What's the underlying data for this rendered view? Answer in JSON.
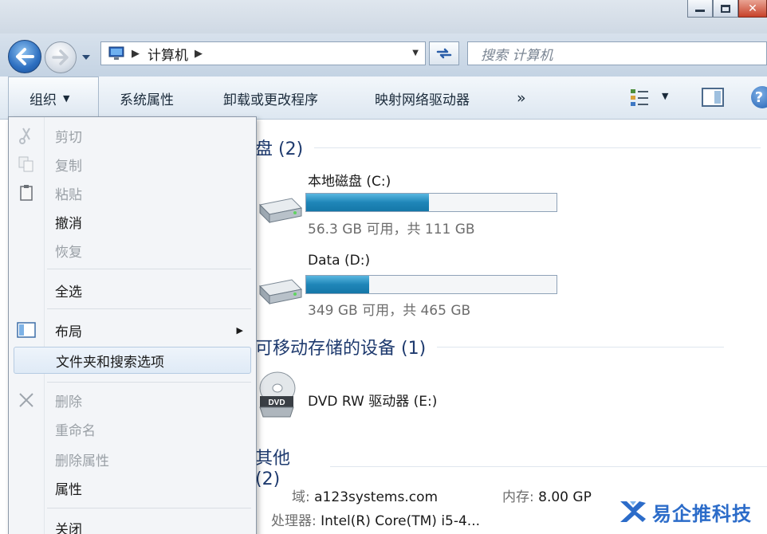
{
  "address_bar": {
    "breadcrumb": "计算机",
    "search_placeholder": "搜索 计算机"
  },
  "toolbar": {
    "organize": "组织",
    "system_properties": "系统属性",
    "uninstall": "卸载或更改程序",
    "map_drive": "映射网络驱动器",
    "more": "»"
  },
  "groups": {
    "hard_disks": "盘 (2)",
    "removable": "可移动存储的设备 (1)",
    "other": "其他 (2)"
  },
  "drives": [
    {
      "name": "本地磁盘 (C:)",
      "free_text": "56.3 GB 可用，共 111 GB",
      "used_fraction": 0.49
    },
    {
      "name": "Data (D:)",
      "free_text": "349 GB 可用，共 465 GB",
      "used_fraction": 0.25
    }
  ],
  "dvd": {
    "name": "DVD RW 驱动器 (E:)"
  },
  "details": {
    "domain_label": "域:",
    "domain_value": "a123systems.com",
    "memory_label": "内存:",
    "memory_value": "8.00 GP",
    "cpu_label": "处理器:",
    "cpu_value": "Intel(R) Core(TM) i5-4..."
  },
  "menu": {
    "cut": "剪切",
    "copy": "复制",
    "paste": "粘贴",
    "undo": "撤消",
    "redo": "恢复",
    "select_all": "全选",
    "layout": "布局",
    "folder_options": "文件夹和搜索选项",
    "delete": "删除",
    "rename": "重命名",
    "remove_properties": "删除属性",
    "properties": "属性",
    "close": "关闭"
  },
  "watermark": {
    "text": "易企推科技"
  }
}
